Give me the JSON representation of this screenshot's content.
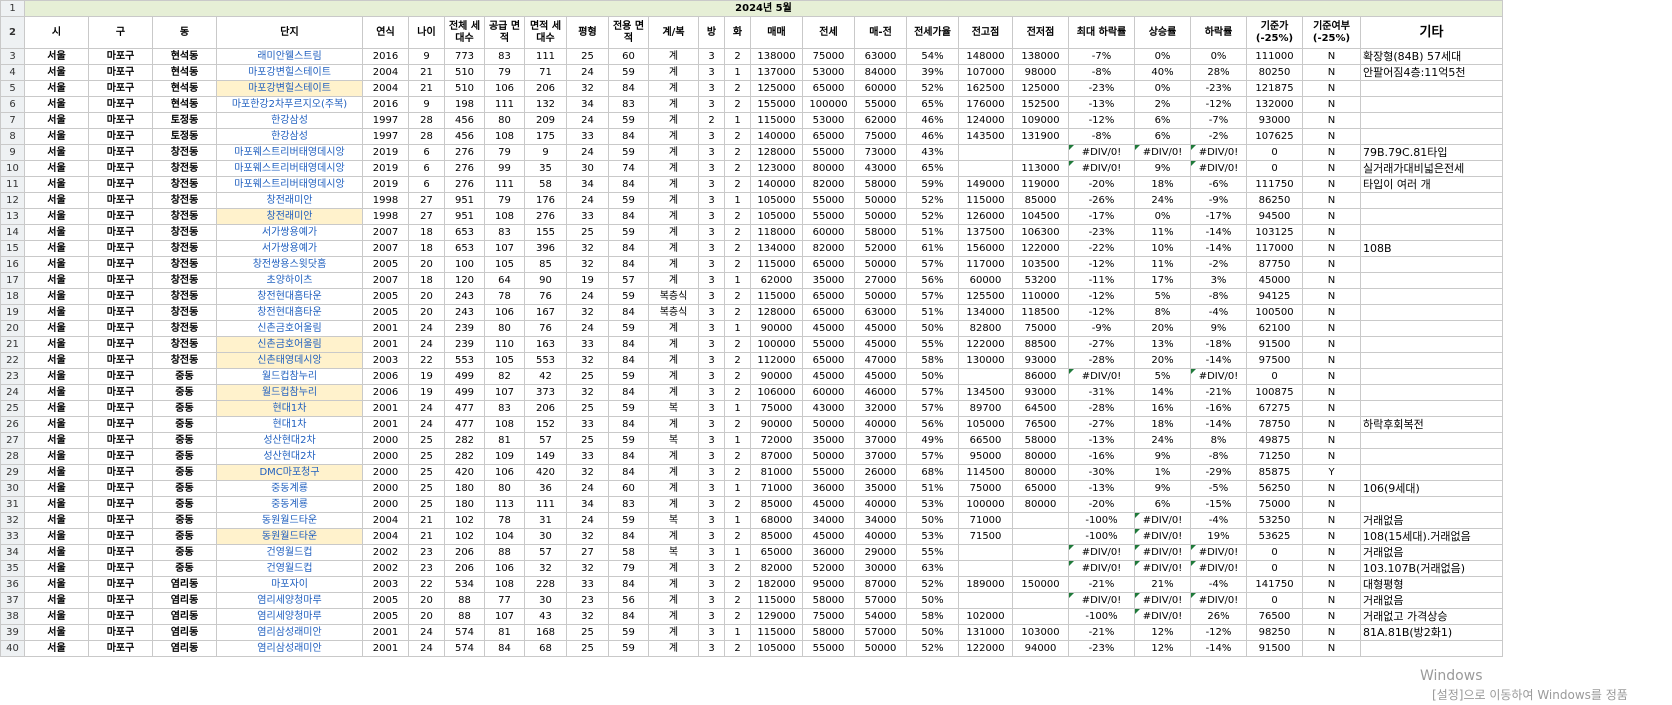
{
  "banner": "2024년 5월",
  "headers": [
    "시",
    "구",
    "동",
    "단지",
    "연식",
    "나이",
    "전체 세대수",
    "공급 면적",
    "면적 세대수",
    "평형",
    "전용 면적",
    "계/복",
    "방",
    "화",
    "매매",
    "전세",
    "매-전",
    "전세가율",
    "전고점",
    "전저점",
    "최대 하락률",
    "상승률",
    "하락률",
    "기준가 (-25%)",
    "기준여부 (-25%)",
    "기타"
  ],
  "rows": [
    [
      "3",
      "서울",
      "마포구",
      "현석동",
      "래미안웰스트림",
      "2016",
      "9",
      "773",
      "83",
      "111",
      "25",
      "60",
      "계",
      "3",
      "2",
      "138000",
      "75000",
      "63000",
      "54%",
      "148000",
      "138000",
      "-7%",
      "0%",
      "0%",
      "111000",
      "N",
      "확장형(84B) 57세대",
      false,
      []
    ],
    [
      "4",
      "서울",
      "마포구",
      "현석동",
      "마포강변힐스테이트",
      "2004",
      "21",
      "510",
      "79",
      "71",
      "24",
      "59",
      "계",
      "3",
      "1",
      "137000",
      "53000",
      "84000",
      "39%",
      "107000",
      "98000",
      "-8%",
      "40%",
      "28%",
      "80250",
      "N",
      "안팔어짐4층:11억5천",
      false,
      []
    ],
    [
      "5",
      "서울",
      "마포구",
      "현석동",
      "마포강변힐스테이트",
      "2004",
      "21",
      "510",
      "106",
      "206",
      "32",
      "84",
      "계",
      "3",
      "2",
      "125000",
      "65000",
      "60000",
      "52%",
      "162500",
      "125000",
      "-23%",
      "0%",
      "-23%",
      "121875",
      "N",
      "",
      true,
      []
    ],
    [
      "6",
      "서울",
      "마포구",
      "현석동",
      "마포한강2차푸르지오(주복)",
      "2016",
      "9",
      "198",
      "111",
      "132",
      "34",
      "83",
      "계",
      "3",
      "2",
      "155000",
      "100000",
      "55000",
      "65%",
      "176000",
      "152500",
      "-13%",
      "2%",
      "-12%",
      "132000",
      "N",
      "",
      false,
      []
    ],
    [
      "7",
      "서울",
      "마포구",
      "토정동",
      "한강삼성",
      "1997",
      "28",
      "456",
      "80",
      "209",
      "24",
      "59",
      "계",
      "2",
      "1",
      "115000",
      "53000",
      "62000",
      "46%",
      "124000",
      "109000",
      "-12%",
      "6%",
      "-7%",
      "93000",
      "N",
      "",
      false,
      []
    ],
    [
      "8",
      "서울",
      "마포구",
      "토정동",
      "한강삼성",
      "1997",
      "28",
      "456",
      "108",
      "175",
      "33",
      "84",
      "계",
      "3",
      "2",
      "140000",
      "65000",
      "75000",
      "46%",
      "143500",
      "131900",
      "-8%",
      "6%",
      "-2%",
      "107625",
      "N",
      "",
      false,
      []
    ],
    [
      "9",
      "서울",
      "마포구",
      "창전동",
      "마포웨스트리버태영데시앙",
      "2019",
      "6",
      "276",
      "79",
      "9",
      "24",
      "59",
      "계",
      "3",
      "2",
      "128000",
      "55000",
      "73000",
      "43%",
      "",
      "",
      "#DIV/0!",
      "#DIV/0!",
      "#DIV/0!",
      "0",
      "N",
      "79B.79C.81타입",
      false,
      [
        21,
        22,
        23
      ]
    ],
    [
      "10",
      "서울",
      "마포구",
      "창전동",
      "마포웨스트리버태영데시앙",
      "2019",
      "6",
      "276",
      "99",
      "35",
      "30",
      "74",
      "계",
      "3",
      "2",
      "123000",
      "80000",
      "43000",
      "65%",
      "",
      "113000",
      "#DIV/0!",
      "9%",
      "#DIV/0!",
      "0",
      "N",
      "실거래가대비넓은전세",
      false,
      [
        21,
        23
      ]
    ],
    [
      "11",
      "서울",
      "마포구",
      "창전동",
      "마포웨스트리버태영데시앙",
      "2019",
      "6",
      "276",
      "111",
      "58",
      "34",
      "84",
      "계",
      "3",
      "2",
      "140000",
      "82000",
      "58000",
      "59%",
      "149000",
      "119000",
      "-20%",
      "18%",
      "-6%",
      "111750",
      "N",
      "타입이 여러 개",
      false,
      []
    ],
    [
      "12",
      "서울",
      "마포구",
      "창전동",
      "창전래미안",
      "1998",
      "27",
      "951",
      "79",
      "176",
      "24",
      "59",
      "계",
      "3",
      "1",
      "105000",
      "55000",
      "50000",
      "52%",
      "115000",
      "85000",
      "-26%",
      "24%",
      "-9%",
      "86250",
      "N",
      "",
      false,
      []
    ],
    [
      "13",
      "서울",
      "마포구",
      "창전동",
      "창전래미안",
      "1998",
      "27",
      "951",
      "108",
      "276",
      "33",
      "84",
      "계",
      "3",
      "2",
      "105000",
      "55000",
      "50000",
      "52%",
      "126000",
      "104500",
      "-17%",
      "0%",
      "-17%",
      "94500",
      "N",
      "",
      true,
      []
    ],
    [
      "14",
      "서울",
      "마포구",
      "창전동",
      "서가쌍용예가",
      "2007",
      "18",
      "653",
      "83",
      "155",
      "25",
      "59",
      "계",
      "3",
      "2",
      "118000",
      "60000",
      "58000",
      "51%",
      "137500",
      "106300",
      "-23%",
      "11%",
      "-14%",
      "103125",
      "N",
      "",
      false,
      []
    ],
    [
      "15",
      "서울",
      "마포구",
      "창전동",
      "서가쌍용예가",
      "2007",
      "18",
      "653",
      "107",
      "396",
      "32",
      "84",
      "계",
      "3",
      "2",
      "134000",
      "82000",
      "52000",
      "61%",
      "156000",
      "122000",
      "-22%",
      "10%",
      "-14%",
      "117000",
      "N",
      "108B",
      false,
      []
    ],
    [
      "16",
      "서울",
      "마포구",
      "창전동",
      "창전쌍용스윗닷홈",
      "2005",
      "20",
      "100",
      "105",
      "85",
      "32",
      "84",
      "계",
      "3",
      "2",
      "115000",
      "65000",
      "50000",
      "57%",
      "117000",
      "103500",
      "-12%",
      "11%",
      "-2%",
      "87750",
      "N",
      "",
      false,
      []
    ],
    [
      "17",
      "서울",
      "마포구",
      "창전동",
      "초양하이츠",
      "2007",
      "18",
      "120",
      "64",
      "90",
      "19",
      "57",
      "계",
      "3",
      "1",
      "62000",
      "35000",
      "27000",
      "56%",
      "60000",
      "53200",
      "-11%",
      "17%",
      "3%",
      "45000",
      "N",
      "",
      false,
      []
    ],
    [
      "18",
      "서울",
      "마포구",
      "창전동",
      "창전현대홈타운",
      "2005",
      "20",
      "243",
      "78",
      "76",
      "24",
      "59",
      "복층식",
      "3",
      "2",
      "115000",
      "65000",
      "50000",
      "57%",
      "125500",
      "110000",
      "-12%",
      "5%",
      "-8%",
      "94125",
      "N",
      "",
      false,
      []
    ],
    [
      "19",
      "서울",
      "마포구",
      "창전동",
      "창전현대홈타운",
      "2005",
      "20",
      "243",
      "106",
      "167",
      "32",
      "84",
      "복층식",
      "3",
      "2",
      "128000",
      "65000",
      "63000",
      "51%",
      "134000",
      "118500",
      "-12%",
      "8%",
      "-4%",
      "100500",
      "N",
      "",
      false,
      []
    ],
    [
      "20",
      "서울",
      "마포구",
      "창전동",
      "신촌금호어울림",
      "2001",
      "24",
      "239",
      "80",
      "76",
      "24",
      "59",
      "계",
      "3",
      "1",
      "90000",
      "45000",
      "45000",
      "50%",
      "82800",
      "75000",
      "-9%",
      "20%",
      "9%",
      "62100",
      "N",
      "",
      false,
      []
    ],
    [
      "21",
      "서울",
      "마포구",
      "창전동",
      "신촌금호어울림",
      "2001",
      "24",
      "239",
      "110",
      "163",
      "33",
      "84",
      "계",
      "3",
      "2",
      "100000",
      "55000",
      "45000",
      "55%",
      "122000",
      "88500",
      "-27%",
      "13%",
      "-18%",
      "91500",
      "N",
      "",
      true,
      []
    ],
    [
      "22",
      "서울",
      "마포구",
      "창전동",
      "신촌태영데시앙",
      "2003",
      "22",
      "553",
      "105",
      "553",
      "32",
      "84",
      "계",
      "3",
      "2",
      "112000",
      "65000",
      "47000",
      "58%",
      "130000",
      "93000",
      "-28%",
      "20%",
      "-14%",
      "97500",
      "N",
      "",
      true,
      []
    ],
    [
      "23",
      "서울",
      "마포구",
      "중동",
      "월드컵참누리",
      "2006",
      "19",
      "499",
      "82",
      "42",
      "25",
      "59",
      "계",
      "3",
      "2",
      "90000",
      "45000",
      "45000",
      "50%",
      "",
      "86000",
      "#DIV/0!",
      "5%",
      "#DIV/0!",
      "0",
      "N",
      "",
      false,
      [
        21,
        23
      ]
    ],
    [
      "24",
      "서울",
      "마포구",
      "중동",
      "월드컵참누리",
      "2006",
      "19",
      "499",
      "107",
      "373",
      "32",
      "84",
      "계",
      "3",
      "2",
      "106000",
      "60000",
      "46000",
      "57%",
      "134500",
      "93000",
      "-31%",
      "14%",
      "-21%",
      "100875",
      "N",
      "",
      true,
      []
    ],
    [
      "25",
      "서울",
      "마포구",
      "중동",
      "현대1차",
      "2001",
      "24",
      "477",
      "83",
      "206",
      "25",
      "59",
      "복",
      "3",
      "1",
      "75000",
      "43000",
      "32000",
      "57%",
      "89700",
      "64500",
      "-28%",
      "16%",
      "-16%",
      "67275",
      "N",
      "",
      true,
      []
    ],
    [
      "26",
      "서울",
      "마포구",
      "중동",
      "현대1차",
      "2001",
      "24",
      "477",
      "108",
      "152",
      "33",
      "84",
      "계",
      "3",
      "2",
      "90000",
      "50000",
      "40000",
      "56%",
      "105000",
      "76500",
      "-27%",
      "18%",
      "-14%",
      "78750",
      "N",
      "하락후회복전",
      false,
      []
    ],
    [
      "27",
      "서울",
      "마포구",
      "중동",
      "성산현대2차",
      "2000",
      "25",
      "282",
      "81",
      "57",
      "25",
      "59",
      "복",
      "3",
      "1",
      "72000",
      "35000",
      "37000",
      "49%",
      "66500",
      "58000",
      "-13%",
      "24%",
      "8%",
      "49875",
      "N",
      "",
      false,
      []
    ],
    [
      "28",
      "서울",
      "마포구",
      "중동",
      "성산현대2차",
      "2000",
      "25",
      "282",
      "109",
      "149",
      "33",
      "84",
      "계",
      "3",
      "2",
      "87000",
      "50000",
      "37000",
      "57%",
      "95000",
      "80000",
      "-16%",
      "9%",
      "-8%",
      "71250",
      "N",
      "",
      false,
      []
    ],
    [
      "29",
      "서울",
      "마포구",
      "중동",
      "DMC마포청구",
      "2000",
      "25",
      "420",
      "106",
      "420",
      "32",
      "84",
      "계",
      "3",
      "2",
      "81000",
      "55000",
      "26000",
      "68%",
      "114500",
      "80000",
      "-30%",
      "1%",
      "-29%",
      "85875",
      "Y",
      "",
      true,
      []
    ],
    [
      "30",
      "서울",
      "마포구",
      "중동",
      "중동계룡",
      "2000",
      "25",
      "180",
      "80",
      "36",
      "24",
      "60",
      "계",
      "3",
      "1",
      "71000",
      "36000",
      "35000",
      "51%",
      "75000",
      "65000",
      "-13%",
      "9%",
      "-5%",
      "56250",
      "N",
      "106(9세대)",
      false,
      []
    ],
    [
      "31",
      "서울",
      "마포구",
      "중동",
      "중동계룡",
      "2000",
      "25",
      "180",
      "113",
      "111",
      "34",
      "83",
      "계",
      "3",
      "2",
      "85000",
      "45000",
      "40000",
      "53%",
      "100000",
      "80000",
      "-20%",
      "6%",
      "-15%",
      "75000",
      "N",
      "",
      false,
      []
    ],
    [
      "32",
      "서울",
      "마포구",
      "중동",
      "동원월드타운",
      "2004",
      "21",
      "102",
      "78",
      "31",
      "24",
      "59",
      "복",
      "3",
      "1",
      "68000",
      "34000",
      "34000",
      "50%",
      "71000",
      "",
      "-100%",
      "#DIV/0!",
      "-4%",
      "53250",
      "N",
      "거래없음",
      false,
      [
        22
      ]
    ],
    [
      "33",
      "서울",
      "마포구",
      "중동",
      "동원월드타운",
      "2004",
      "21",
      "102",
      "104",
      "30",
      "32",
      "84",
      "계",
      "3",
      "2",
      "85000",
      "45000",
      "40000",
      "53%",
      "71500",
      "",
      "-100%",
      "#DIV/0!",
      "19%",
      "53625",
      "N",
      "108(15세대).거래없음",
      true,
      [
        22
      ]
    ],
    [
      "34",
      "서울",
      "마포구",
      "중동",
      "건영월드컵",
      "2002",
      "23",
      "206",
      "88",
      "57",
      "27",
      "58",
      "복",
      "3",
      "1",
      "65000",
      "36000",
      "29000",
      "55%",
      "",
      "",
      "#DIV/0!",
      "#DIV/0!",
      "#DIV/0!",
      "0",
      "N",
      "거래없음",
      false,
      [
        21,
        22,
        23
      ]
    ],
    [
      "35",
      "서울",
      "마포구",
      "중동",
      "건영월드컵",
      "2002",
      "23",
      "206",
      "106",
      "32",
      "32",
      "79",
      "계",
      "3",
      "2",
      "82000",
      "52000",
      "30000",
      "63%",
      "",
      "",
      "#DIV/0!",
      "#DIV/0!",
      "#DIV/0!",
      "0",
      "N",
      "103.107B(거래없음)",
      false,
      [
        21,
        22,
        23
      ]
    ],
    [
      "36",
      "서울",
      "마포구",
      "염리동",
      "마포자이",
      "2003",
      "22",
      "534",
      "108",
      "228",
      "33",
      "84",
      "계",
      "3",
      "2",
      "182000",
      "95000",
      "87000",
      "52%",
      "189000",
      "150000",
      "-21%",
      "21%",
      "-4%",
      "141750",
      "N",
      "대형평형",
      false,
      []
    ],
    [
      "37",
      "서울",
      "마포구",
      "염리동",
      "염리세양청마루",
      "2005",
      "20",
      "88",
      "77",
      "30",
      "23",
      "56",
      "계",
      "3",
      "2",
      "115000",
      "58000",
      "57000",
      "50%",
      "",
      "",
      "#DIV/0!",
      "#DIV/0!",
      "#DIV/0!",
      "0",
      "N",
      "거래없음",
      false,
      [
        21,
        22,
        23
      ]
    ],
    [
      "38",
      "서울",
      "마포구",
      "염리동",
      "염리세양청마루",
      "2005",
      "20",
      "88",
      "107",
      "43",
      "32",
      "84",
      "계",
      "3",
      "2",
      "129000",
      "75000",
      "54000",
      "58%",
      "102000",
      "",
      "-100%",
      "#DIV/0!",
      "26%",
      "76500",
      "N",
      "거래없고 가격상승",
      false,
      [
        22
      ]
    ],
    [
      "39",
      "서울",
      "마포구",
      "염리동",
      "염리삼성래미안",
      "2001",
      "24",
      "574",
      "81",
      "168",
      "25",
      "59",
      "계",
      "3",
      "1",
      "115000",
      "58000",
      "57000",
      "50%",
      "131000",
      "103000",
      "-21%",
      "12%",
      "-12%",
      "98250",
      "N",
      "81A.81B(방2화1)",
      false,
      []
    ],
    [
      "40",
      "서울",
      "마포구",
      "염리동",
      "염리삼성래미안",
      "2001",
      "24",
      "574",
      "84",
      "68",
      "25",
      "59",
      "계",
      "3",
      "2",
      "105000",
      "55000",
      "50000",
      "52%",
      "122000",
      "94000",
      "-23%",
      "12%",
      "-14%",
      "91500",
      "N",
      "",
      false,
      []
    ]
  ],
  "watermark_line1": "Windows",
  "watermark_line2": "[설정]으로 이동하여 Windows를 정품"
}
